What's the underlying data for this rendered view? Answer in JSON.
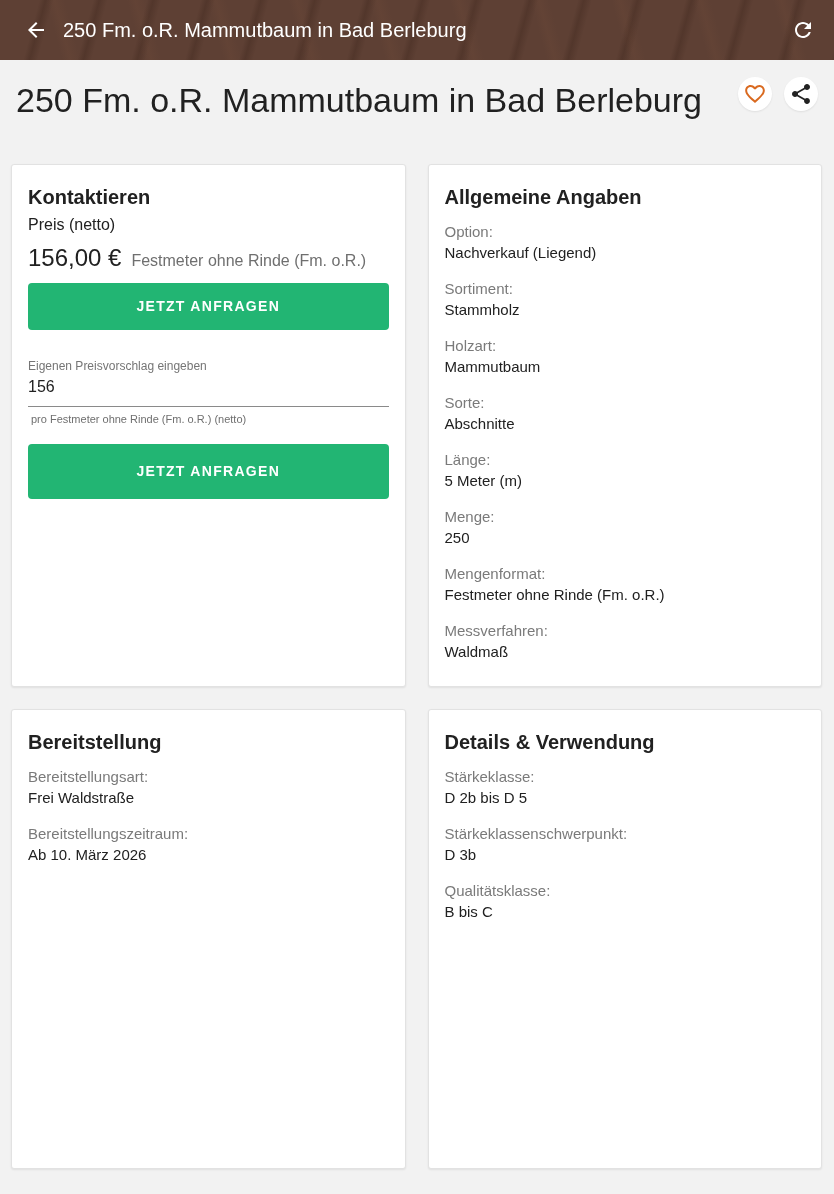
{
  "app_bar": {
    "title": "250 Fm. o.R. Mammutbaum in Bad Berleburg"
  },
  "page_title": "250 Fm. o.R. Mammutbaum in Bad Berleburg",
  "favorite": {
    "on": false
  },
  "cards": [
    {
      "kind": "contact",
      "title": "Kontaktieren",
      "price_label": "Preis (netto)",
      "price": "156,00 €",
      "price_unit": "Festmeter ohne Rinde (Fm. o.R.)",
      "request_button": "JETZT ANFRAGEN",
      "offer_field": {
        "label": "Eigenen Preisvorschlag eingeben",
        "value": "156",
        "helper": "pro Festmeter ohne Rinde (Fm. o.R.) (netto)"
      },
      "offer_button": "JETZT ANFRAGEN"
    },
    {
      "kind": "details",
      "title": "Allgemeine Angaben",
      "fields": [
        {
          "label": "Option:",
          "value": "Nachverkauf (Liegend)"
        },
        {
          "label": "Sortiment:",
          "value": "Stammholz"
        },
        {
          "label": "Holzart:",
          "value": "Mammutbaum"
        },
        {
          "label": "Sorte:",
          "value": "Abschnitte"
        },
        {
          "label": "Länge:",
          "value": "5 Meter (m)"
        },
        {
          "label": "Menge:",
          "value": "250"
        },
        {
          "label": "Mengenformat:",
          "value": "Festmeter ohne Rinde (Fm. o.R.)"
        },
        {
          "label": "Messverfahren:",
          "value": "Waldmaß"
        }
      ]
    },
    {
      "kind": "details",
      "title": "Bereitstellung",
      "fields": [
        {
          "label": "Bereitstellungsart:",
          "value": "Frei Waldstraße"
        },
        {
          "label": "Bereitstellungszeitraum:",
          "value": "Ab 10. März 2026"
        }
      ]
    },
    {
      "kind": "details",
      "title": "Details & Verwendung",
      "fields": [
        {
          "label": "Stärkeklasse:",
          "value": "D 2b bis D 5"
        },
        {
          "label": "Stärkeklassenschwerpunkt:",
          "value": "D 3b"
        },
        {
          "label": "Qualitätsklasse:",
          "value": "B bis C"
        }
      ]
    }
  ]
}
